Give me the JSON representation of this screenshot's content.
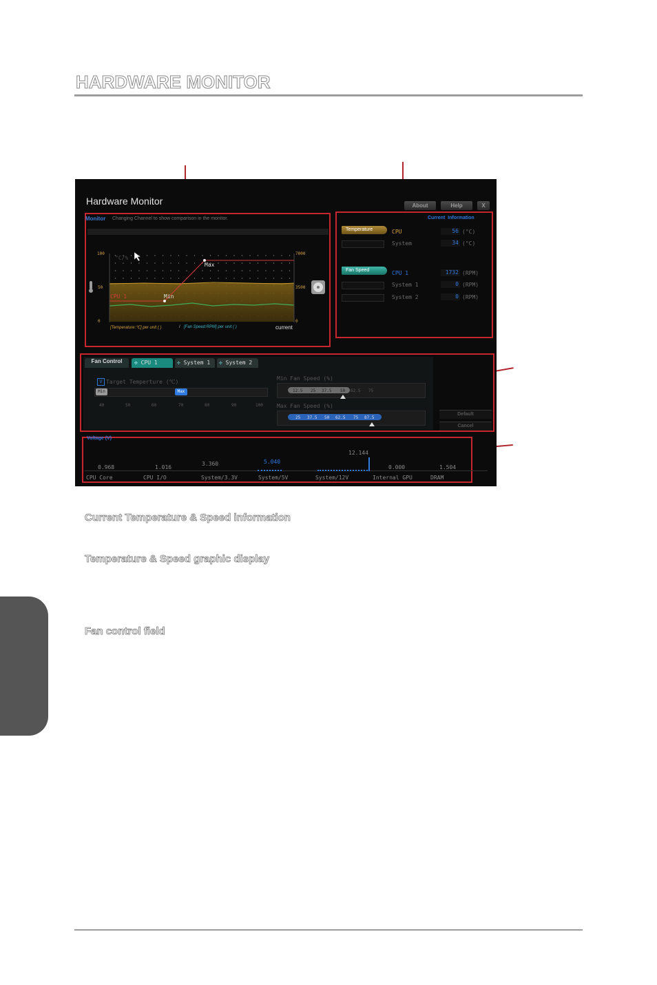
{
  "doc": {
    "title": "HARDWARE MONITOR",
    "sections": [
      "Current Temperature & Speed information",
      "Temperature & Speed graphic display",
      "Fan control field"
    ]
  },
  "app": {
    "window_title": "Hardware Monitor",
    "buttons": {
      "about": "About",
      "help": "Help",
      "close": "X"
    },
    "monitor": {
      "heading": "Monitor",
      "description": "Changing Channel to show comparison in the monitor.",
      "y_left": [
        "100",
        "50",
        "0"
      ],
      "y_right": [
        "7000",
        "3500",
        "0"
      ],
      "series_label": "CPU 1",
      "min_label": "Min",
      "max_label": "Max",
      "left_glyph": "°C/%",
      "legend_temp": "[Temperature:℃] per unit (     )",
      "legend_sep": "/",
      "legend_fan": "[Fan Speed:RPM] per unit (     )",
      "current_label": "current",
      "colors": {
        "temp_fill": "#6a5312",
        "fan_line": "#3fae5a",
        "curve": "#d33a3a"
      }
    },
    "current_info": {
      "heading": "Current  Information",
      "temperature_button": "Temperature",
      "fan_button": "Fan Speed",
      "temps": [
        {
          "label": "CPU",
          "value": "56",
          "unit": "(°C)"
        },
        {
          "label": "System",
          "value": "34",
          "unit": "(°C)"
        }
      ],
      "fans": [
        {
          "label": "CPU 1",
          "value": "1732",
          "unit": "(RPM)"
        },
        {
          "label": "System 1",
          "value": "0",
          "unit": "(RPM)"
        },
        {
          "label": "System 2",
          "value": "0",
          "unit": "(RPM)"
        }
      ]
    },
    "fan_control": {
      "title": "Fan Control",
      "tabs": [
        "CPU 1",
        "System 1",
        "System 2"
      ],
      "target_check": "V",
      "target_label": "Target Temperture (℃)",
      "min_marker": "Min",
      "max_marker": "Max",
      "temp_ticks": [
        "40",
        "50",
        "60",
        "70",
        "80",
        "90",
        "100"
      ],
      "min_fan_label": "Min Fan Speed (%)",
      "min_fan_steps": [
        "12.5",
        "25",
        "37.5",
        "50",
        "62.5",
        "75"
      ],
      "max_fan_label": "Max Fan Speed (%)",
      "max_fan_steps": [
        "25",
        "37.5",
        "50",
        "62.5",
        "75",
        "87.5"
      ],
      "default_button": "Default",
      "cancel_button": "Cancel"
    },
    "voltage": {
      "heading": "Voltage (V)",
      "items": [
        {
          "label": "CPU Core",
          "value": "0.968"
        },
        {
          "label": "CPU I/O",
          "value": "1.016"
        },
        {
          "label": "System/3.3V",
          "value": "3.360"
        },
        {
          "label": "System/5V",
          "value": "5.040"
        },
        {
          "label": "System/12V",
          "value": "12.144"
        },
        {
          "label": "Internal GPU",
          "value": "0.000"
        },
        {
          "label": "DRAM",
          "value": "1.504"
        }
      ]
    }
  }
}
